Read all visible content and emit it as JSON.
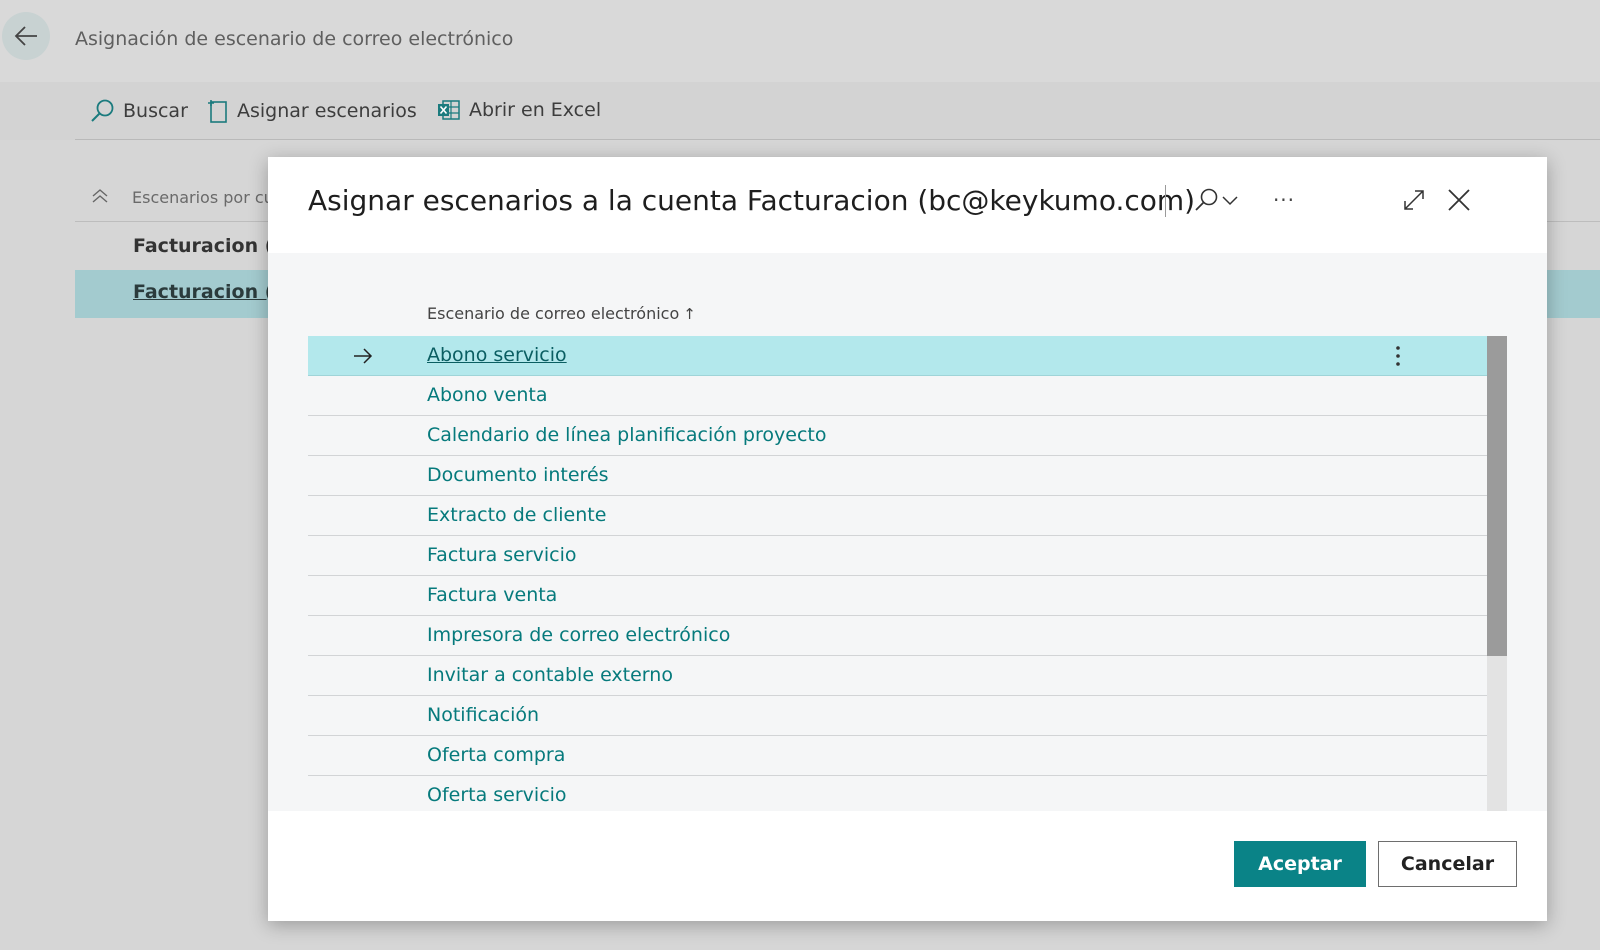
{
  "page": {
    "title": "Asignación de escenario de correo electrónico",
    "actions": {
      "search": "Buscar",
      "assign": "Asignar escenarios",
      "excel": "Abrir en Excel"
    },
    "list_header": "Escenarios por cue",
    "rows": [
      "Facturacion (fa",
      "Facturacion (b"
    ]
  },
  "modal": {
    "title": "Asignar escenarios a la cuenta Facturacion (bc@keykumo.com)",
    "column_header": "Escenario de correo electrónico",
    "sort_indicator": "↑",
    "more_glyph": "···",
    "rows": [
      "Abono servicio",
      "Abono venta",
      "Calendario de línea planificación proyecto",
      "Documento interés",
      "Extracto de cliente",
      "Factura servicio",
      "Factura venta",
      "Impresora de correo electrónico",
      "Invitar a contable externo",
      "Notificación",
      "Oferta compra",
      "Oferta servicio"
    ],
    "selected_index": 0,
    "ok_label": "Aceptar",
    "cancel_label": "Cancelar"
  },
  "colors": {
    "accent": "#0a8387",
    "link": "#067a7c",
    "selected_row": "#b3e8ec"
  }
}
